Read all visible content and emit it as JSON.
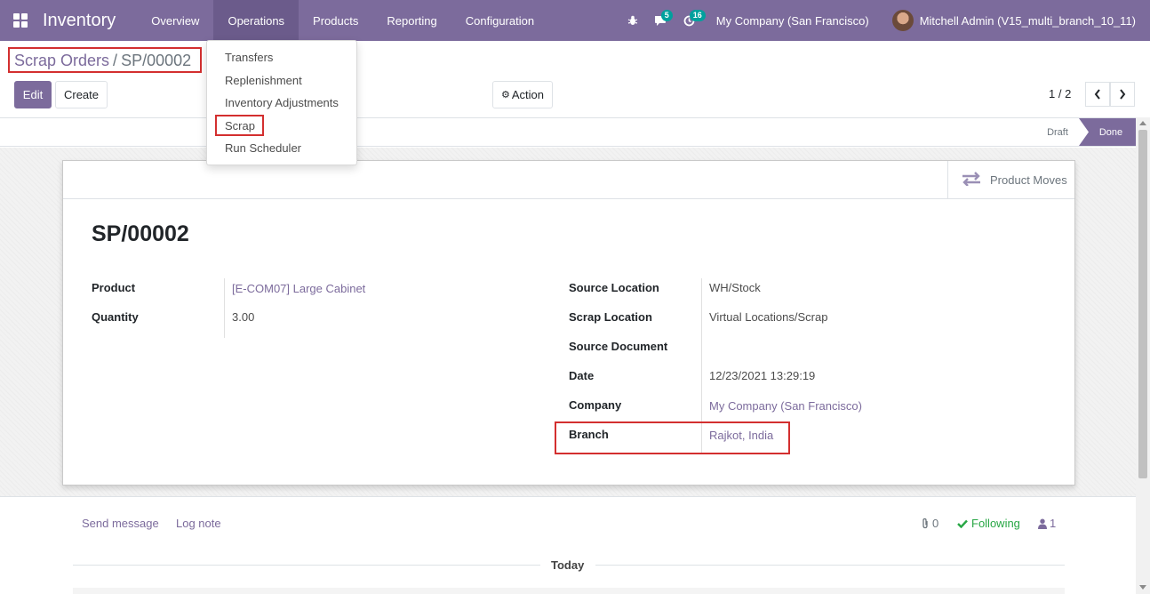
{
  "navbar": {
    "app_name": "Inventory",
    "menu": [
      "Overview",
      "Operations",
      "Products",
      "Reporting",
      "Configuration"
    ],
    "active_menu": "Operations",
    "messages_count": "5",
    "activities_count": "16",
    "company": "My Company (San Francisco)",
    "user": "Mitchell Admin (V15_multi_branch_10_11)"
  },
  "dropdown": {
    "items": [
      "Transfers",
      "Replenishment",
      "Inventory Adjustments",
      "Scrap",
      "Run Scheduler"
    ]
  },
  "breadcrumb": {
    "parent": "Scrap Orders",
    "separator": "/",
    "current": "SP/00002"
  },
  "buttons": {
    "edit": "Edit",
    "create": "Create",
    "action": "Action"
  },
  "pager": {
    "value": "1 / 2"
  },
  "status": {
    "draft": "Draft",
    "done": "Done",
    "current": "Done"
  },
  "smart_button": {
    "label": "Product Moves"
  },
  "record": {
    "title": "SP/00002",
    "left_fields": [
      {
        "label": "Product",
        "value": "[E-COM07] Large Cabinet"
      },
      {
        "label": "Quantity",
        "value": "3.00"
      }
    ],
    "right_fields": [
      {
        "label": "Source Location",
        "value": "WH/Stock"
      },
      {
        "label": "Scrap Location",
        "value": "Virtual Locations/Scrap"
      },
      {
        "label": "Source Document",
        "value": ""
      },
      {
        "label": "Date",
        "value": "12/23/2021 13:29:19"
      },
      {
        "label": "Company",
        "value": "My Company (San Francisco)"
      },
      {
        "label": "Branch",
        "value": "Rajkot, India"
      }
    ]
  },
  "chatter": {
    "send_message": "Send message",
    "log_note": "Log note",
    "attachments": "0",
    "following": "Following",
    "followers": "1",
    "today": "Today"
  },
  "colors": {
    "brand": "#7c6b9c",
    "highlight": "#d32f2f",
    "badge": "#00a09d",
    "following": "#28a745"
  }
}
